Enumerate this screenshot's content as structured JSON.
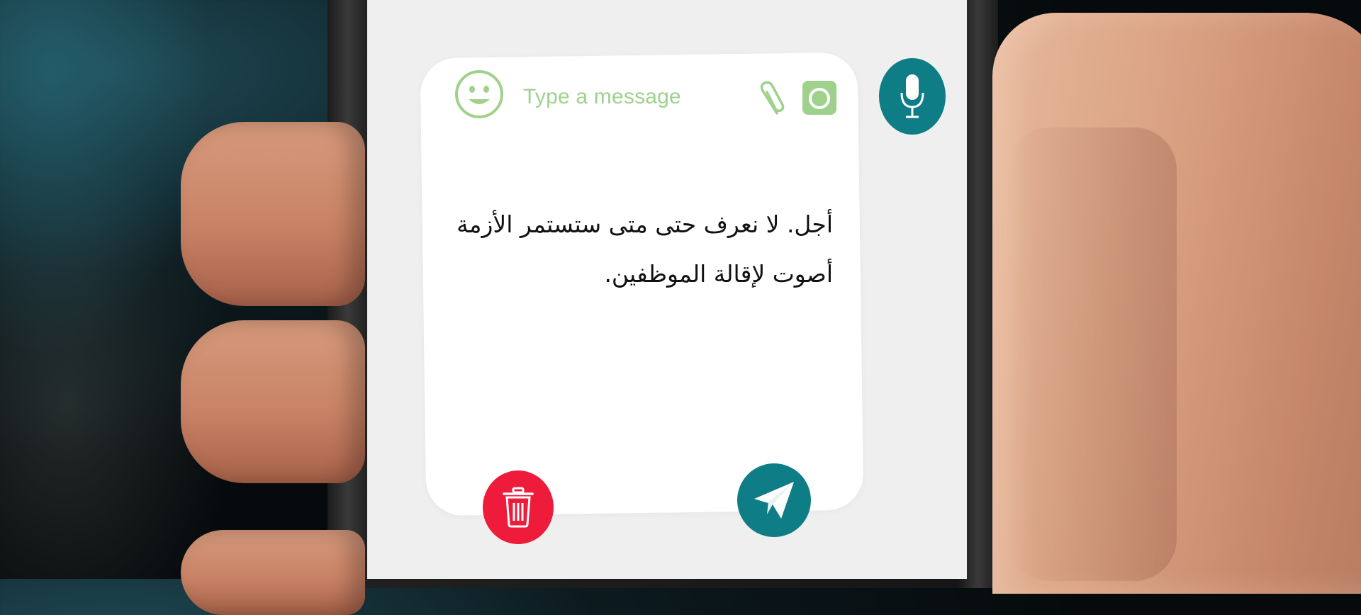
{
  "compose": {
    "placeholder": "Type a message",
    "message_lines": [
      "أجل. لا نعرف حتى متى ستستمر الأزمة",
      "أصوت لإقالة الموظفين."
    ]
  },
  "icons": {
    "emoji": "smiley-face-icon",
    "attach": "paperclip-icon",
    "camera": "camera-icon",
    "mic": "microphone-icon",
    "delete": "trash-icon",
    "send": "paper-plane-icon"
  },
  "colors": {
    "accent_teal": "#0f7d86",
    "delete_red": "#ef1b3b",
    "icon_green": "#9fd18d",
    "screen_bg": "#efefef",
    "card_bg": "#ffffff"
  }
}
